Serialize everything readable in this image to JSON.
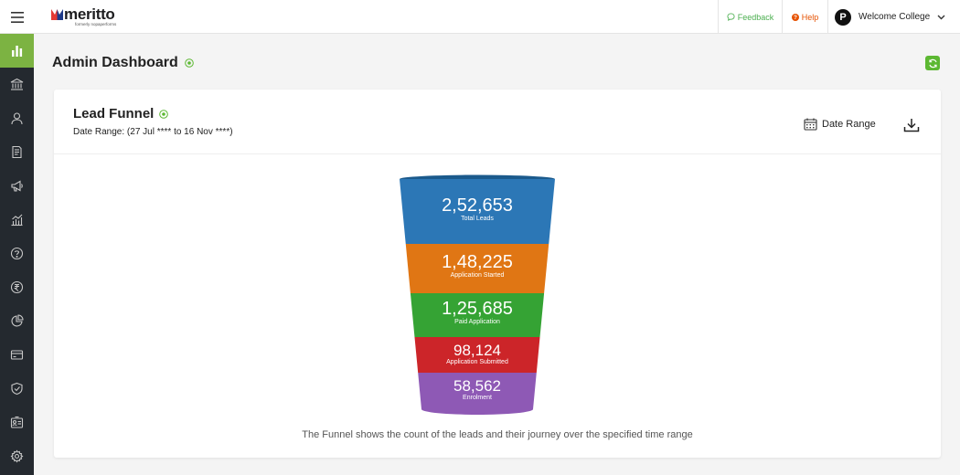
{
  "topbar": {
    "logo_text": "meritto",
    "logo_subtext": "formerly nopaperforms",
    "feedback_label": "Feedback",
    "help_label": "Help",
    "avatar_letter": "P",
    "user_name": "Welcome College"
  },
  "sidebar": {
    "items": [
      {
        "icon": "bar-chart-icon",
        "active": true
      },
      {
        "icon": "institution-icon",
        "active": false
      },
      {
        "icon": "user-icon",
        "active": false
      },
      {
        "icon": "document-icon",
        "active": false
      },
      {
        "icon": "megaphone-icon",
        "active": false
      },
      {
        "icon": "analytics-icon",
        "active": false
      },
      {
        "icon": "help-icon",
        "active": false
      },
      {
        "icon": "rupee-icon",
        "active": false
      },
      {
        "icon": "pie-chart-icon",
        "active": false
      },
      {
        "icon": "card-icon",
        "active": false
      },
      {
        "icon": "shield-icon",
        "active": false
      },
      {
        "icon": "id-card-icon",
        "active": false
      },
      {
        "icon": "settings-icon",
        "active": false
      }
    ]
  },
  "header": {
    "title": "Admin Dashboard"
  },
  "card": {
    "title": "Lead Funnel",
    "date_range_text": "Date Range: (27 Jul **** to 16 Nov ****)",
    "date_range_button": "Date Range",
    "caption": "The Funnel shows the count of the leads and their journey over the specified time range"
  },
  "funnel": [
    {
      "value": "2,52,653",
      "label": "Total Leads",
      "color": "#2c77b6"
    },
    {
      "value": "1,48,225",
      "label": "Application Started",
      "color": "#e07614"
    },
    {
      "value": "1,25,685",
      "label": "Paid Application",
      "color": "#35a334"
    },
    {
      "value": "98,124",
      "label": "Application Submitted",
      "color": "#cc2529"
    },
    {
      "value": "58,562",
      "label": "Enrolment",
      "color": "#8e59b5"
    }
  ],
  "colors": {
    "accent": "#7cb342",
    "sidebar_bg": "#24292f",
    "funnel_top": "#1b5a8c"
  }
}
